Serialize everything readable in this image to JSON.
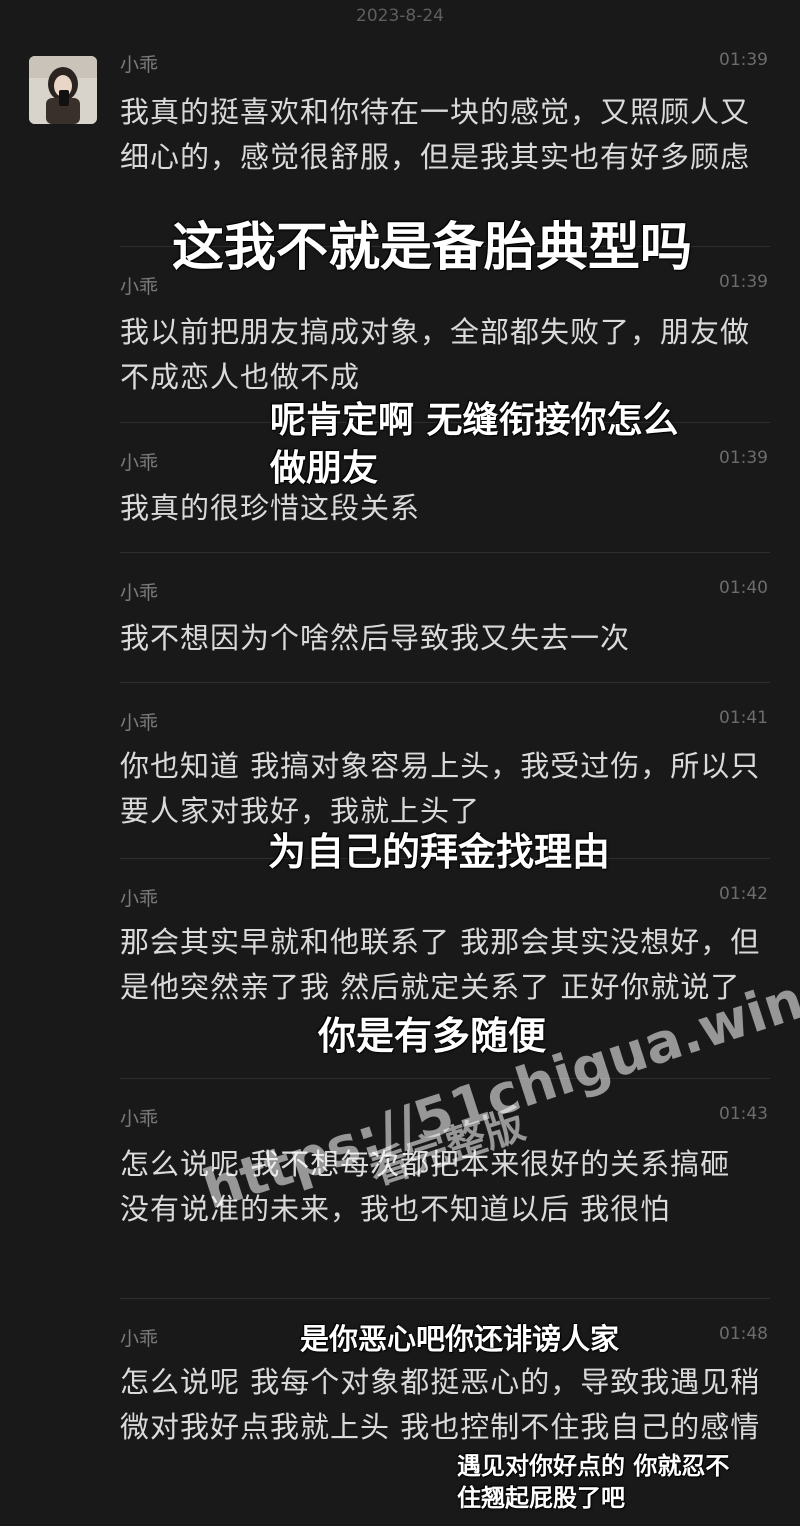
{
  "date_header": "2023-8-24",
  "messages": [
    {
      "sender": "小乖",
      "time": "01:39",
      "text": "我真的挺喜欢和你待在一块的感觉，又照顾人又细心的，感觉很舒服，但是我其实也有好多顾虑"
    },
    {
      "sender": "小乖",
      "time": "01:39",
      "text": "我以前把朋友搞成对象，全部都失败了，朋友做不成恋人也做不成"
    },
    {
      "sender": "小乖",
      "time": "01:39",
      "text": "我真的很珍惜这段关系"
    },
    {
      "sender": "小乖",
      "time": "01:40",
      "text": "我不想因为个啥然后导致我又失去一次"
    },
    {
      "sender": "小乖",
      "time": "01:41",
      "text": "你也知道 我搞对象容易上头，我受过伤，所以只要人家对我好，我就上头了"
    },
    {
      "sender": "小乖",
      "time": "01:42",
      "text": "那会其实早就和他联系了 我那会其实没想好，但是他突然亲了我 然后就定关系了 正好你就说了"
    },
    {
      "sender": "小乖",
      "time": "01:43",
      "text": "怎么说呢 我不想每次都把本来很好的关系搞砸 没有说准的未来，我也不知道以后 我很怕"
    },
    {
      "sender": "小乖",
      "time": "01:48",
      "text": "怎么说呢  我每个对象都挺恶心的，导致我遇见稍微对我好点我就上头 我也控制不住我自己的感情"
    }
  ],
  "overlays": {
    "caption_1": "这我不就是备胎典型吗",
    "caption_2_line1": "呢肯定啊 无缝衔接你怎么",
    "caption_2_line2": "做朋友",
    "caption_3": "为自己的拜金找理由",
    "caption_4": "你是有多随便",
    "caption_5": "是你恶心吧你还诽谤人家",
    "caption_6_line1": "遇见对你好点的 你就忍不",
    "caption_6_line2": "住翘起屁股了吧"
  },
  "watermark": {
    "url": "https://51chigua.win",
    "tag": "看完整版"
  }
}
